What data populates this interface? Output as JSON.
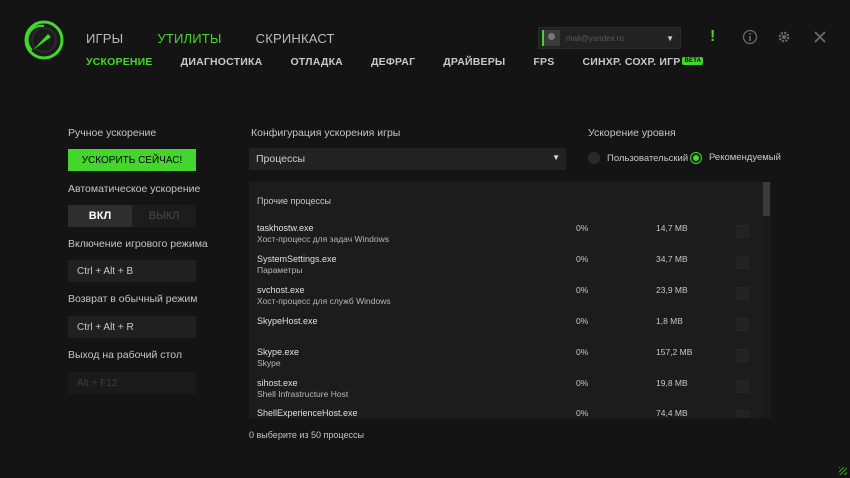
{
  "app": {
    "accent": "#44d62c",
    "logo_icon": "razer-cortex-logo-icon"
  },
  "top_nav": {
    "tabs": [
      {
        "label": "ИГРЫ",
        "active": false
      },
      {
        "label": "УТИЛИТЫ",
        "active": true
      },
      {
        "label": "СКРИНКАСТ",
        "active": false
      }
    ]
  },
  "sub_nav": {
    "tabs": [
      {
        "label": "УСКОРЕНИЕ",
        "active": true
      },
      {
        "label": "ДИАГНОСТИКА",
        "active": false
      },
      {
        "label": "ОТЛАДКА",
        "active": false
      },
      {
        "label": "ДЕФРАГ",
        "active": false
      },
      {
        "label": "ДРАЙВЕРЫ",
        "active": false
      },
      {
        "label": "FPS",
        "active": false
      },
      {
        "label": "СИНХР. СОХР. ИГР",
        "active": false,
        "badge": "BETA"
      }
    ]
  },
  "account": {
    "email": "mail@yandex.ru"
  },
  "window_controls": {
    "alert_label": "!",
    "alert_icon": "alert-icon",
    "help_icon": "info-icon",
    "settings_icon": "gear-icon",
    "close_icon": "close-icon"
  },
  "left_panel": {
    "manual_boost_label": "Ручное ускорение",
    "boost_now_button": "УСКОРИТЬ СЕЙЧАС!",
    "auto_boost_label": "Автоматическое ускорение",
    "toggle_on": "ВКЛ",
    "toggle_off": "ВЫКЛ",
    "toggle_state": "on",
    "game_mode_label": "Включение игрового режима",
    "game_mode_hotkey": "Ctrl + Alt + B",
    "normal_mode_label": "Возврат в обычный режим",
    "normal_mode_hotkey": "Ctrl + Alt + R",
    "desktop_label": "Выход на рабочий стол",
    "desktop_hotkey": "Alt + F12"
  },
  "config": {
    "title": "Конфигурация ускорения игры",
    "dropdown_value": "Процессы"
  },
  "level": {
    "title": "Ускорение уровня",
    "options": [
      {
        "label": "Пользовательский",
        "checked": false
      },
      {
        "label": "Рекомендуемый",
        "checked": true
      }
    ]
  },
  "process_table": {
    "group_header": "Прочие процессы",
    "rows": [
      {
        "name": "taskhostw.exe",
        "desc": "Хост-процесс для задач Windows",
        "cpu": "0%",
        "mem": "14,7 MB"
      },
      {
        "name": "SystemSettings.exe",
        "desc": "Параметры",
        "cpu": "0%",
        "mem": "34,7 MB"
      },
      {
        "name": "svchost.exe",
        "desc": "Хост-процесс для служб Windows",
        "cpu": "0%",
        "mem": "23,9 MB"
      },
      {
        "name": "SkypeHost.exe",
        "desc": "",
        "cpu": "0%",
        "mem": "1,8 MB"
      },
      {
        "name": "Skype.exe",
        "desc": "Skype",
        "cpu": "0%",
        "mem": "157,2 MB"
      },
      {
        "name": "sihost.exe",
        "desc": "Shell Infrastructure Host",
        "cpu": "0%",
        "mem": "19,8 MB"
      },
      {
        "name": "ShellExperienceHost.exe",
        "desc": "",
        "cpu": "0%",
        "mem": "74,4 MB"
      }
    ],
    "footer": "0 выберите из 50 процессы"
  }
}
